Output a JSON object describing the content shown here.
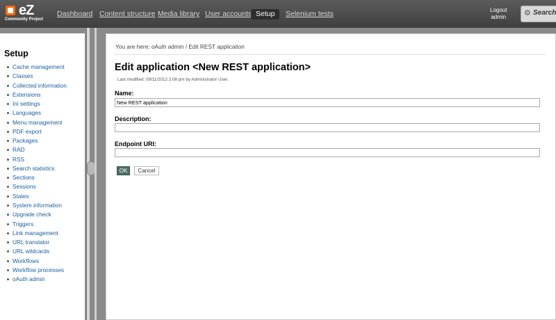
{
  "header": {
    "logo_text": "eZ",
    "logo_sub": "Community Project",
    "tabs": [
      {
        "label": "Dashboard"
      },
      {
        "label": "Content structure"
      },
      {
        "label": "Media library"
      },
      {
        "label": "User accounts"
      },
      {
        "label": "Setup",
        "active": true
      },
      {
        "label": "Selenium tests"
      }
    ],
    "logout_label": "Logout",
    "user_name": "admin",
    "search_label": "Search"
  },
  "sidebar": {
    "title": "Setup",
    "items": [
      "Cache management",
      "Classes",
      "Collected information",
      "Extensions",
      "Ini settings",
      "Languages",
      "Menu management",
      "PDF export",
      "Packages",
      "RAD",
      "RSS",
      "Search statistics",
      "Sections",
      "Sessions",
      "States",
      "System information",
      "Upgrade check",
      "Triggers",
      "Link management",
      "URL translator",
      "URL wildcards",
      "Workflows",
      "Workflow processes",
      "oAuth admin"
    ]
  },
  "main": {
    "breadcrumb": "You are here: oAuth admin / Edit REST application",
    "title": "Edit application <New REST application>",
    "modified": "Last modified: 09/11/2012 2:08 pm by Administrator User.",
    "fields": {
      "name": {
        "label": "Name:",
        "value": "New REST application"
      },
      "description": {
        "label": "Description:",
        "value": ""
      },
      "endpoint": {
        "label": "Endpoint URI:",
        "value": ""
      }
    },
    "ok_label": "OK",
    "cancel_label": "Cancel"
  },
  "colors": {
    "accent": "#ff6600",
    "link": "#1a5fa0",
    "ok_button": "#4f6f6a"
  }
}
